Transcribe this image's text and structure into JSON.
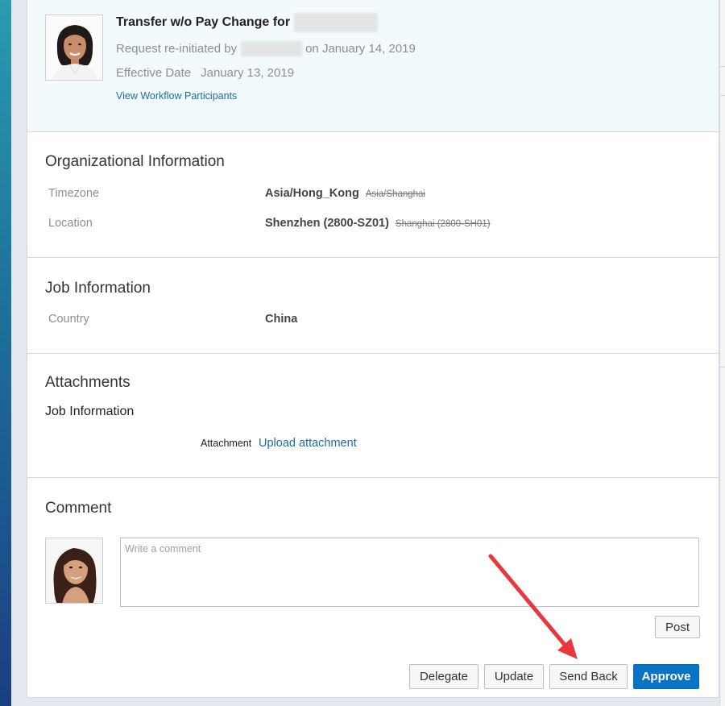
{
  "header": {
    "title_prefix": "Transfer w/o Pay Change for",
    "request_prefix": "Request re-initiated by",
    "request_suffix": "on January 14, 2019",
    "effective_label": "Effective Date",
    "effective_value": "January 13, 2019",
    "workflow_link": "View Workflow Participants"
  },
  "org_info": {
    "title": "Organizational Information",
    "fields": [
      {
        "label": "Timezone",
        "value": "Asia/Hong_Kong",
        "old_value": "Asia/Shanghai"
      },
      {
        "label": "Location",
        "value": "Shenzhen (2800-SZ01)",
        "old_value": "Shanghai (2800-SH01)"
      }
    ]
  },
  "job_info": {
    "title": "Job Information",
    "fields": [
      {
        "label": "Country",
        "value": "China"
      }
    ]
  },
  "attachments": {
    "title": "Attachments",
    "subtitle": "Job Information",
    "attachment_label": "Attachment",
    "upload_link": "Upload attachment"
  },
  "comment": {
    "title": "Comment",
    "placeholder": "Write a comment",
    "post_label": "Post"
  },
  "actions": {
    "delegate": "Delegate",
    "update": "Update",
    "send_back": "Send Back",
    "approve": "Approve"
  },
  "colors": {
    "accent": "#0a74c4",
    "link": "#1c6ea4",
    "annotation_arrow": "#e8383d",
    "header_bg": "#f2fafb"
  }
}
